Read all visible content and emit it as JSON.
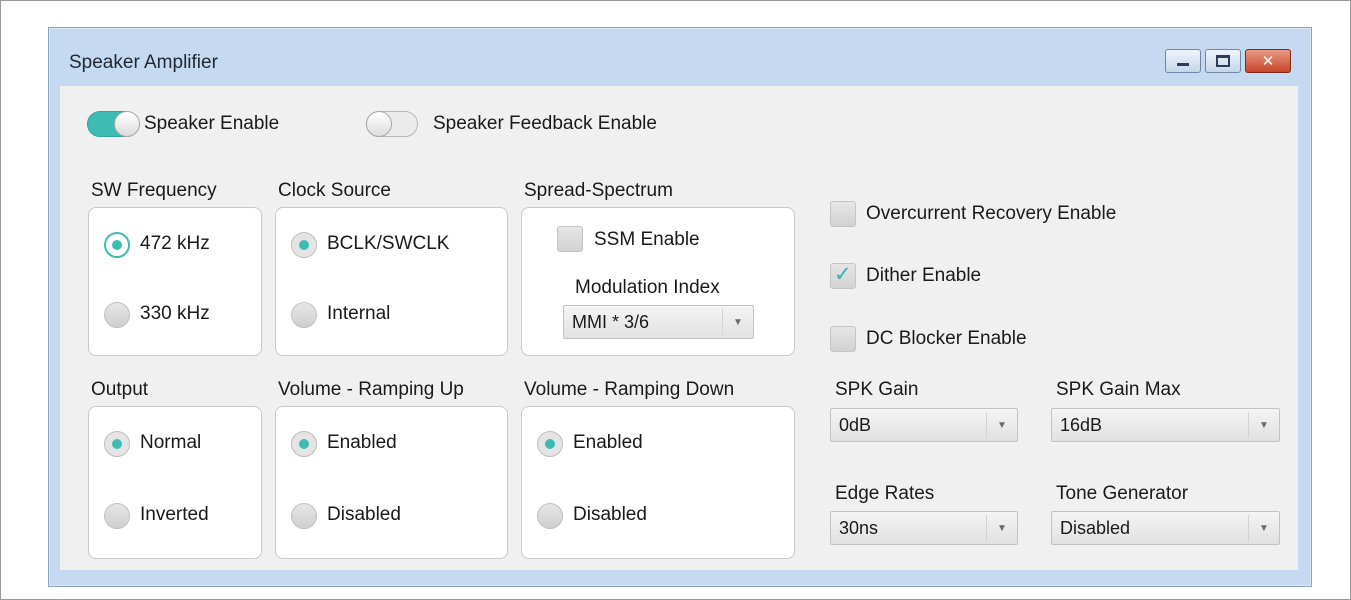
{
  "window": {
    "title": "Speaker Amplifier",
    "buttons": {
      "minimize": "minimize-icon",
      "maximize": "maximize-icon",
      "close": "close-icon"
    }
  },
  "toggles": {
    "speaker_enable": {
      "label": "Speaker Enable",
      "on": true
    },
    "speaker_feedback_enable": {
      "label": "Speaker Feedback Enable",
      "on": false
    }
  },
  "sw_frequency": {
    "title": "SW Frequency",
    "options": [
      "472 kHz",
      "330 kHz"
    ],
    "selected": "472 kHz"
  },
  "clock_source": {
    "title": "Clock Source",
    "options": [
      "BCLK/SWCLK",
      "Internal"
    ],
    "selected": "BCLK/SWCLK"
  },
  "spread_spectrum": {
    "title": "Spread-Spectrum",
    "ssm_enable": {
      "label": "SSM Enable",
      "checked": false
    },
    "modulation_index": {
      "label": "Modulation Index",
      "value": "MMI * 3/6"
    }
  },
  "output": {
    "title": "Output",
    "options": [
      "Normal",
      "Inverted"
    ],
    "selected": "Normal"
  },
  "volume_ramping_up": {
    "title": "Volume - Ramping Up",
    "options": [
      "Enabled",
      "Disabled"
    ],
    "selected": "Enabled"
  },
  "volume_ramping_down": {
    "title": "Volume - Ramping Down",
    "options": [
      "Enabled",
      "Disabled"
    ],
    "selected": "Enabled"
  },
  "checkboxes": {
    "overcurrent_recovery": {
      "label": "Overcurrent Recovery Enable",
      "checked": false
    },
    "dither": {
      "label": "Dither Enable",
      "checked": true
    },
    "dc_blocker": {
      "label": "DC Blocker Enable",
      "checked": false
    }
  },
  "spk_gain": {
    "label": "SPK Gain",
    "value": "0dB"
  },
  "spk_gain_max": {
    "label": "SPK Gain Max",
    "value": "16dB"
  },
  "edge_rates": {
    "label": "Edge Rates",
    "value": "30ns"
  },
  "tone_generator": {
    "label": "Tone Generator",
    "value": "Disabled"
  },
  "colors": {
    "accent": "#3ebcb3",
    "frame": "#c5daf0",
    "client_bg": "#f0f0f0",
    "close_button": "#c7452b"
  }
}
